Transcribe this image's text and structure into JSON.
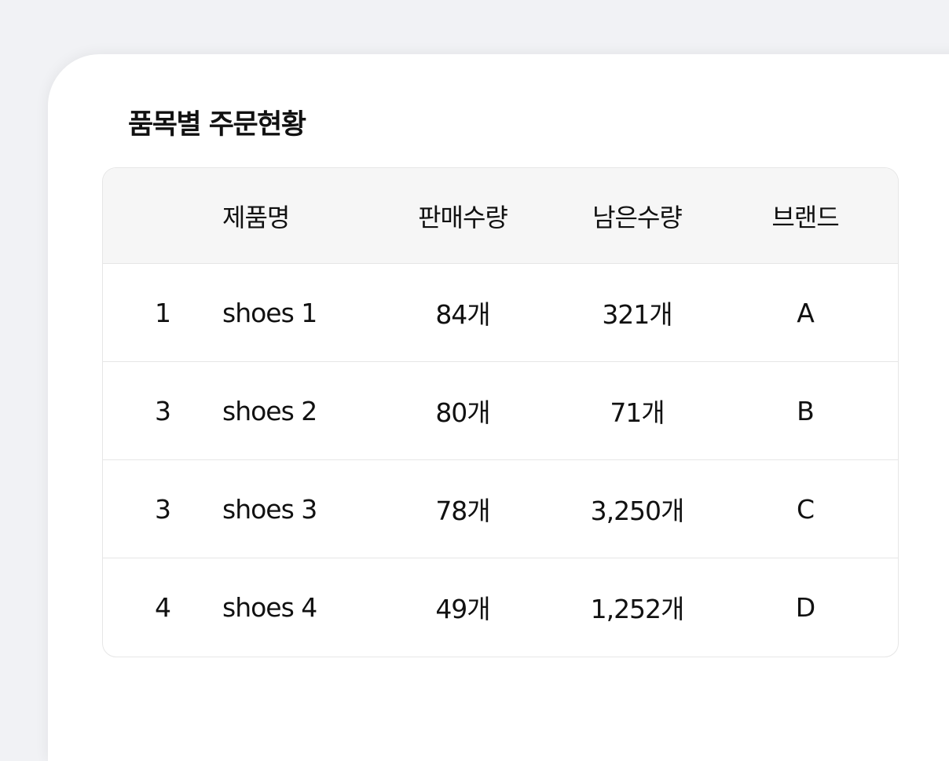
{
  "title": "품목별 주문현황",
  "table": {
    "headers": {
      "rank": "",
      "name": "제품명",
      "sold": "판매수량",
      "remaining": "남은수량",
      "brand": "브랜드"
    },
    "rows": [
      {
        "rank": "1",
        "name": "shoes 1",
        "sold": "84개",
        "remaining": "321개",
        "brand": "A"
      },
      {
        "rank": "3",
        "name": "shoes 2",
        "sold": "80개",
        "remaining": "71개",
        "brand": "B"
      },
      {
        "rank": "3",
        "name": "shoes 3",
        "sold": "78개",
        "remaining": "3,250개",
        "brand": "C"
      },
      {
        "rank": "4",
        "name": "shoes 4",
        "sold": "49개",
        "remaining": "1,252개",
        "brand": "D"
      }
    ]
  }
}
